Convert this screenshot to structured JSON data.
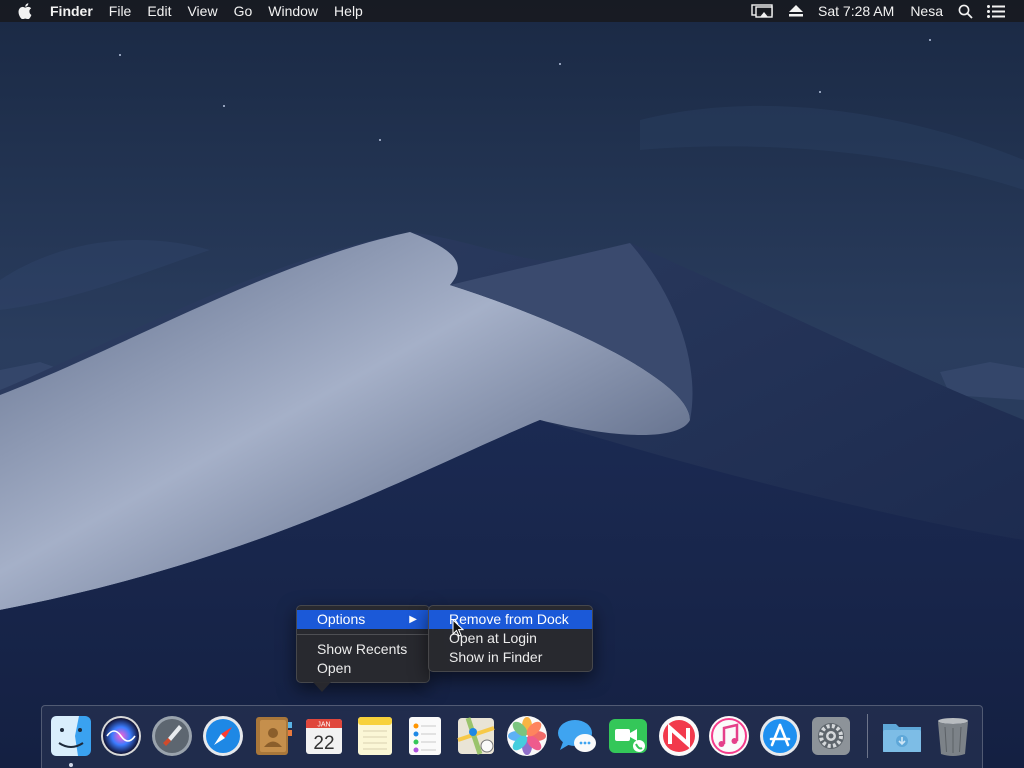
{
  "menubar": {
    "apple_icon": "apple-logo",
    "app_name": "Finder",
    "menus": [
      "File",
      "Edit",
      "View",
      "Go",
      "Window",
      "Help"
    ],
    "status": {
      "airplay_icon": "airplay-display-icon",
      "eject_icon": "eject-icon",
      "clock": "Sat 7:28 AM",
      "user": "Nesa",
      "search_icon": "spotlight-search-icon",
      "notifications_icon": "notification-center-icon"
    }
  },
  "context_menu": {
    "items": [
      "Options",
      "Show Recents",
      "Open"
    ],
    "highlighted": "Options",
    "submenu": {
      "items": [
        "Remove from Dock",
        "Open at Login",
        "Show in Finder"
      ],
      "highlighted": "Remove from Dock"
    }
  },
  "dock": {
    "apps": [
      {
        "name": "Finder",
        "icon": "finder-icon",
        "running": true
      },
      {
        "name": "Siri",
        "icon": "siri-icon"
      },
      {
        "name": "Launchpad",
        "icon": "launchpad-icon"
      },
      {
        "name": "Safari",
        "icon": "safari-icon"
      },
      {
        "name": "Contacts",
        "icon": "contacts-icon"
      },
      {
        "name": "Calendar",
        "icon": "calendar-icon",
        "month": "JAN",
        "day": "22"
      },
      {
        "name": "Notes",
        "icon": "notes-icon"
      },
      {
        "name": "Reminders",
        "icon": "reminders-icon"
      },
      {
        "name": "Maps",
        "icon": "maps-icon"
      },
      {
        "name": "Photos",
        "icon": "photos-icon"
      },
      {
        "name": "Messages",
        "icon": "messages-icon"
      },
      {
        "name": "FaceTime",
        "icon": "facetime-icon"
      },
      {
        "name": "News",
        "icon": "news-icon"
      },
      {
        "name": "iTunes",
        "icon": "itunes-icon"
      },
      {
        "name": "App Store",
        "icon": "app-store-icon"
      },
      {
        "name": "System Preferences",
        "icon": "system-preferences-icon"
      }
    ],
    "others": [
      {
        "name": "Downloads",
        "icon": "downloads-folder-icon"
      },
      {
        "name": "Trash",
        "icon": "trash-icon"
      }
    ]
  },
  "colors": {
    "menu_highlight": "#1b59d8",
    "menubar_bg": "#181a20",
    "sky_top": "#1b2a45",
    "dune_light": "#a7b3cc"
  }
}
